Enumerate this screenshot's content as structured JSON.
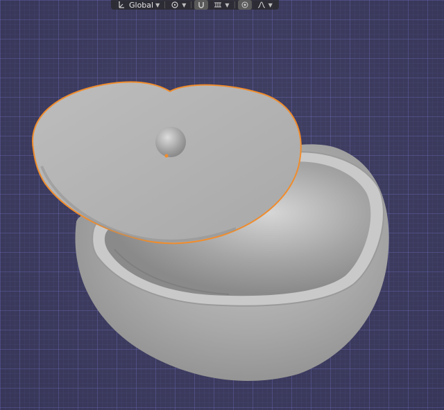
{
  "header": {
    "orientation_icon": "transform-orientation-icon",
    "orientation_label": "Global",
    "pivot_icon": "pivot-point-icon",
    "snap_icon": "snap-magnet-icon",
    "snap_target_icon": "snap-increment-icon",
    "proportional_icon": "proportional-editing-icon",
    "falloff_icon": "falloff-curve-icon"
  },
  "scene": {
    "objects": [
      "bowl",
      "lid",
      "lid-knob"
    ],
    "selected": "lid",
    "selection_color": "#f08c2c",
    "background_color": "#3c3b60",
    "model_color": "#b5b5b5"
  }
}
